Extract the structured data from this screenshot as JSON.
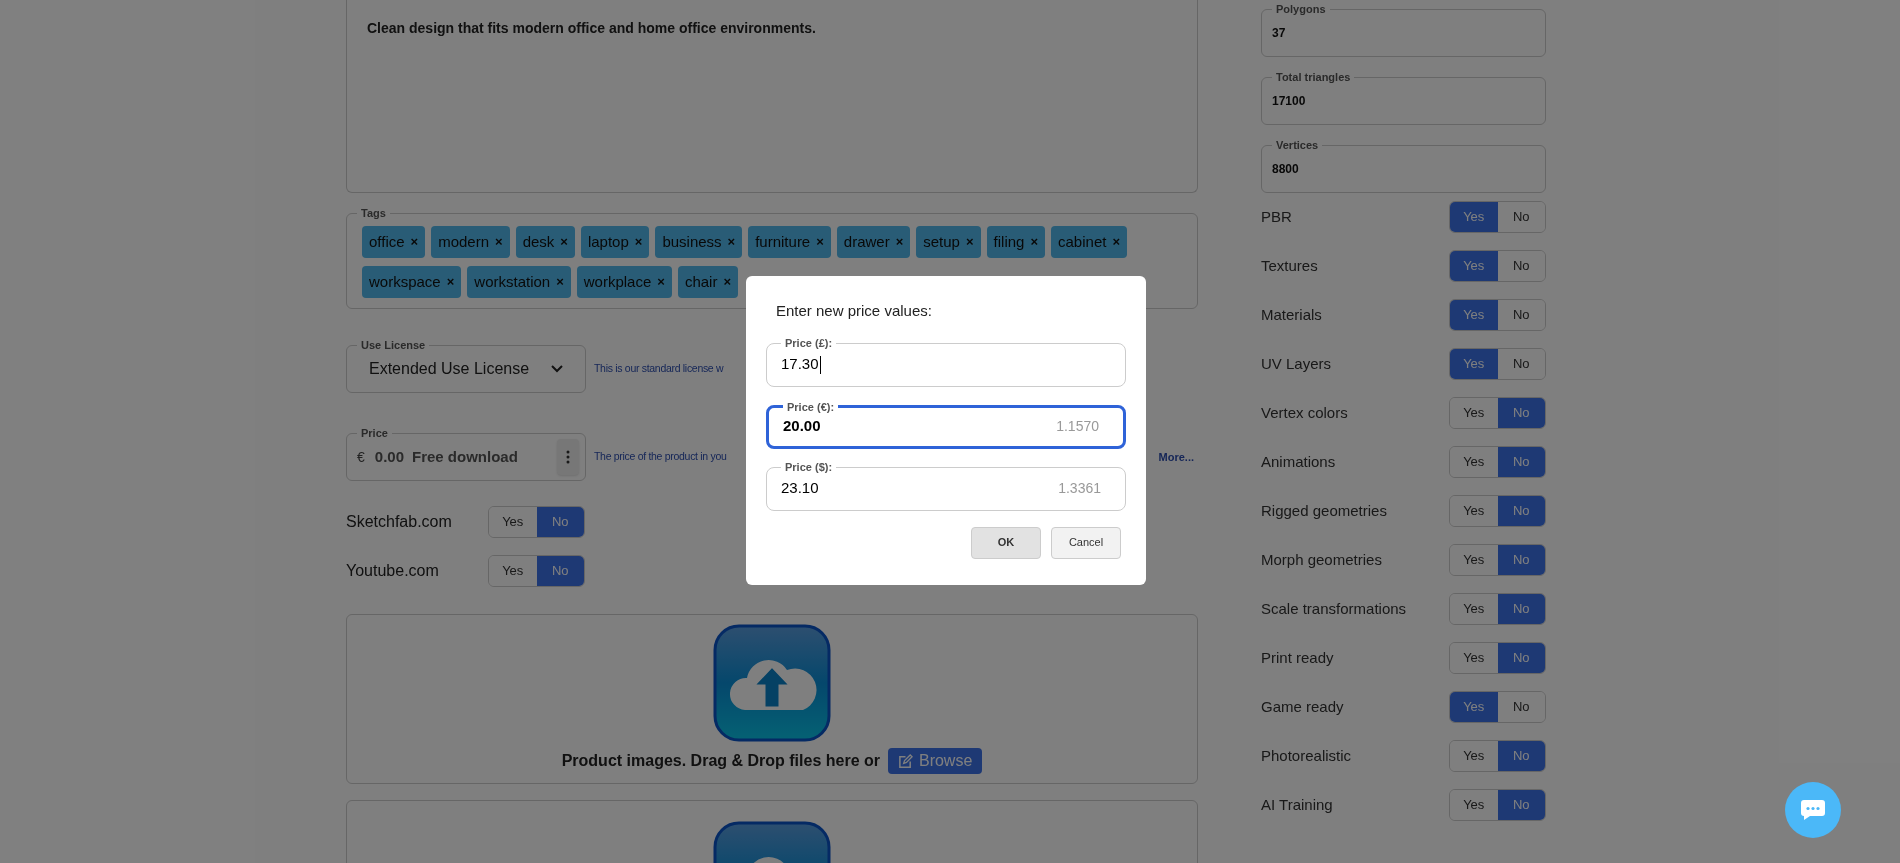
{
  "description": {
    "text": "Clean design that fits modern office and home office environments."
  },
  "tags": {
    "label": "Tags",
    "items": [
      {
        "label": "office"
      },
      {
        "label": "modern"
      },
      {
        "label": "desk"
      },
      {
        "label": "laptop"
      },
      {
        "label": "business"
      },
      {
        "label": "furniture"
      },
      {
        "label": "drawer"
      },
      {
        "label": "setup"
      },
      {
        "label": "filing"
      },
      {
        "label": "cabinet"
      },
      {
        "label": "workspace"
      },
      {
        "label": "workstation"
      },
      {
        "label": "workplace"
      },
      {
        "label": "chair"
      }
    ],
    "remove": "×"
  },
  "license": {
    "label": "Use License",
    "value": "Extended Use License",
    "hint": "This is our standard license w"
  },
  "price": {
    "label": "Price",
    "currency": "€",
    "amount": "0.00",
    "note": "Free download",
    "hint": "The price of the product in you",
    "more": "More..."
  },
  "platforms": [
    {
      "label": "Sketchfab.com",
      "yes": "Yes",
      "no": "No",
      "on": false
    },
    {
      "label": "Youtube.com",
      "yes": "Yes",
      "no": "No",
      "on": false
    }
  ],
  "upload": {
    "text": "Product images. Drag & Drop files here or",
    "browse": "Browse"
  },
  "stats": [
    {
      "label": "Polygons",
      "value": "37"
    },
    {
      "label": "Total triangles",
      "value": "17100"
    },
    {
      "label": "Vertices",
      "value": "8800"
    }
  ],
  "features": [
    {
      "label": "PBR",
      "yes": "Yes",
      "no": "No",
      "on": true
    },
    {
      "label": "Textures",
      "yes": "Yes",
      "no": "No",
      "on": true
    },
    {
      "label": "Materials",
      "yes": "Yes",
      "no": "No",
      "on": true
    },
    {
      "label": "UV Layers",
      "yes": "Yes",
      "no": "No",
      "on": true
    },
    {
      "label": "Vertex colors",
      "yes": "Yes",
      "no": "No",
      "on": false
    },
    {
      "label": "Animations",
      "yes": "Yes",
      "no": "No",
      "on": false
    },
    {
      "label": "Rigged geometries",
      "yes": "Yes",
      "no": "No",
      "on": false
    },
    {
      "label": "Morph geometries",
      "yes": "Yes",
      "no": "No",
      "on": false
    },
    {
      "label": "Scale transformations",
      "yes": "Yes",
      "no": "No",
      "on": false
    },
    {
      "label": "Print ready",
      "yes": "Yes",
      "no": "No",
      "on": false
    },
    {
      "label": "Game ready",
      "yes": "Yes",
      "no": "No",
      "on": true
    },
    {
      "label": "Photorealistic",
      "yes": "Yes",
      "no": "No",
      "on": false
    },
    {
      "label": "AI Training",
      "yes": "Yes",
      "no": "No",
      "on": false
    }
  ],
  "dialog": {
    "title": "Enter new price values:",
    "fields": [
      {
        "label": "Price (£):",
        "value": "17.30",
        "focused": false
      },
      {
        "label": "Price (€):",
        "value": "20.00",
        "rate": "1.1570",
        "focused": true
      },
      {
        "label": "Price ($):",
        "value": "23.10",
        "rate": "1.3361",
        "focused": false
      }
    ],
    "buttons": [
      {
        "label": "OK",
        "kind": "primary"
      },
      {
        "label": "Cancel",
        "kind": "secondary"
      }
    ]
  }
}
